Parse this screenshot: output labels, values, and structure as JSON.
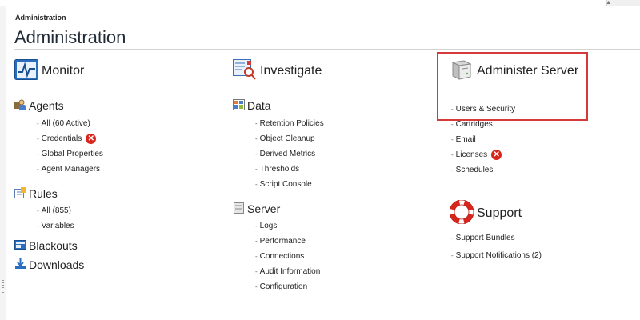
{
  "breadcrumb": "Administration",
  "page_title": "Administration",
  "monitor": {
    "title": "Monitor",
    "agents": {
      "title": "Agents",
      "items": [
        "All (60 Active)",
        "Credentials",
        "Global Properties",
        "Agent Managers"
      ]
    },
    "rules": {
      "title": "Rules",
      "items": [
        "All  (855)",
        "Variables"
      ]
    },
    "blackouts": "Blackouts",
    "downloads": "Downloads"
  },
  "investigate": {
    "title": "Investigate",
    "data": {
      "title": "Data",
      "items": [
        "Retention Policies",
        "Object Cleanup",
        "Derived Metrics",
        "Thresholds",
        "Script Console"
      ]
    },
    "server": {
      "title": "Server",
      "items": [
        "Logs",
        "Performance",
        "Connections",
        "Audit Information",
        "Configuration"
      ]
    }
  },
  "administer": {
    "title": "Administer Server",
    "items": [
      "Users & Security",
      "Cartridges",
      "Email",
      "Licenses",
      "Schedules"
    ]
  },
  "support": {
    "title": "Support",
    "items": [
      "Support Bundles",
      "Support Notifications (2)"
    ]
  },
  "colors": {
    "highlight": "#d43a3a",
    "error": "#d9261c",
    "icon_blue": "#2a6fbf"
  },
  "icons": [
    "monitor-icon",
    "agents-icon",
    "rules-icon",
    "blackouts-icon",
    "downloads-icon",
    "investigate-icon",
    "data-icon",
    "server-icon",
    "administer-server-icon",
    "support-icon",
    "error-icon"
  ]
}
